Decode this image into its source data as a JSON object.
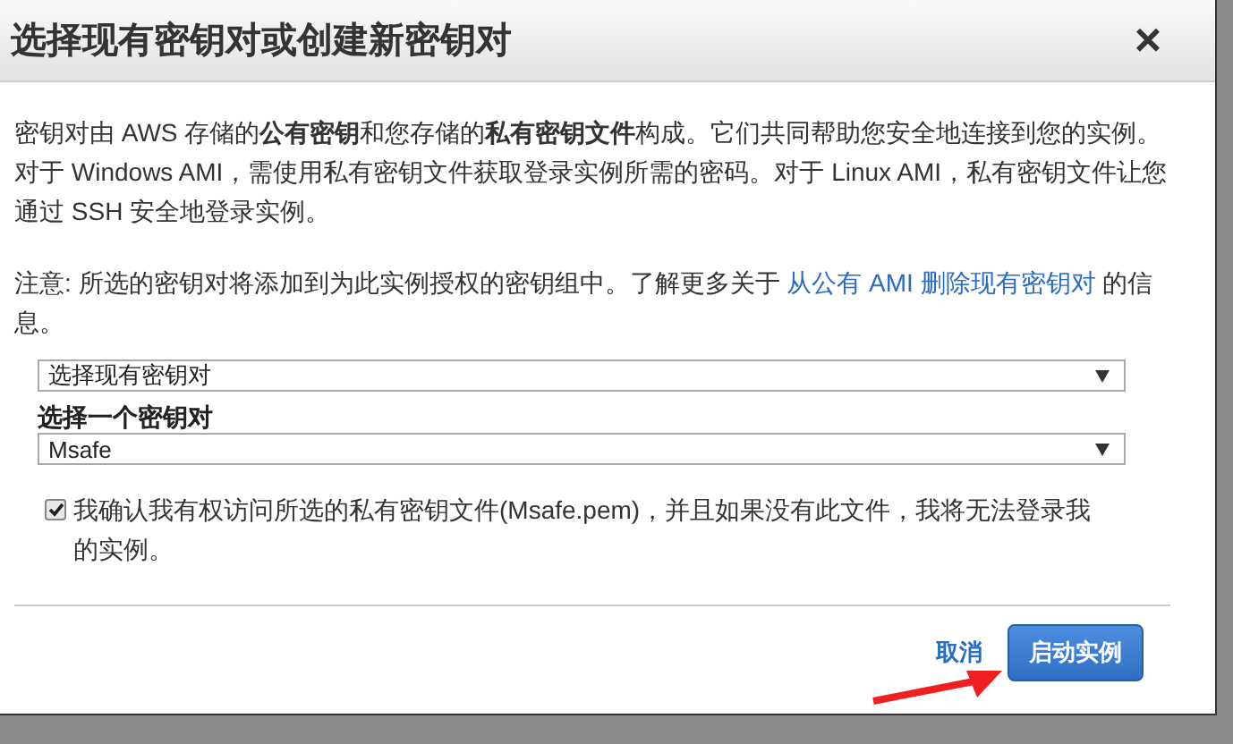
{
  "dialog": {
    "title": "选择现有密钥对或创建新密钥对",
    "close": "×",
    "description": "密钥对由 AWS 存储的**公有密钥**和您存储的**私有密钥文件**构成。它们共同帮助您安全地连接到您的实例。对于 Windows AMI，需使用私有密钥文件获取登录实例所需的密码。对于 Linux AMI，私有密钥文件让您通过 SSH 安全地登录实例。",
    "note": {
      "prefix": "注意: 所选的密钥对将添加到为此实例授权的密钥组中。了解更多关于 ",
      "link": "从公有 AMI 删除现有密钥对",
      "suffix": " 的信息。"
    },
    "mode_select": {
      "value": "选择现有密钥对"
    },
    "key_pair_label": "选择一个密钥对",
    "key_pair_select": {
      "value": "Msafe"
    },
    "acknowledge": {
      "checked": true,
      "label": "我确认我有权访问所选的私有密钥文件(Msafe.pem)，并且如果没有此文件，我将无法登录我的实例。"
    },
    "buttons": [
      {
        "kind": "link",
        "label": "取消"
      },
      {
        "kind": "primary",
        "label": "启动实例"
      }
    ]
  }
}
